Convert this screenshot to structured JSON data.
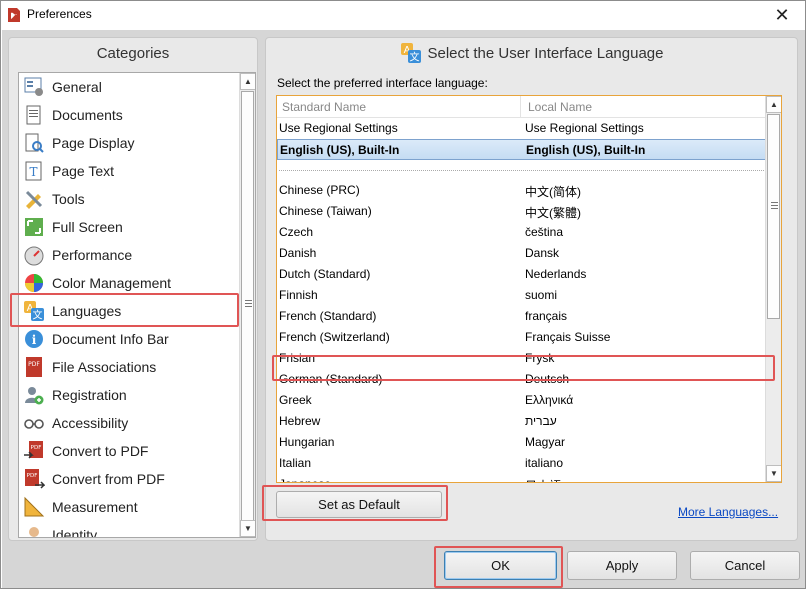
{
  "window": {
    "title": "Preferences",
    "close_glyph": "✕"
  },
  "categories": {
    "header": "Categories",
    "items": [
      {
        "label": "General",
        "icon": "general-settings-icon"
      },
      {
        "label": "Documents",
        "icon": "documents-icon"
      },
      {
        "label": "Page Display",
        "icon": "page-display-icon"
      },
      {
        "label": "Page Text",
        "icon": "page-text-icon"
      },
      {
        "label": "Tools",
        "icon": "tools-icon"
      },
      {
        "label": "Full Screen",
        "icon": "full-screen-icon"
      },
      {
        "label": "Performance",
        "icon": "performance-icon"
      },
      {
        "label": "Color Management",
        "icon": "color-management-icon"
      },
      {
        "label": "Languages",
        "icon": "languages-icon"
      },
      {
        "label": "Document Info Bar",
        "icon": "info-icon"
      },
      {
        "label": "File Associations",
        "icon": "pdf-file-icon"
      },
      {
        "label": "Registration",
        "icon": "registration-icon"
      },
      {
        "label": "Accessibility",
        "icon": "accessibility-glasses-icon"
      },
      {
        "label": "Convert to PDF",
        "icon": "convert-to-pdf-icon"
      },
      {
        "label": "Convert from PDF",
        "icon": "convert-from-pdf-icon"
      },
      {
        "label": "Measurement",
        "icon": "measurement-icon"
      },
      {
        "label": "Identity",
        "icon": "identity-icon"
      }
    ],
    "selected": "Languages"
  },
  "language_panel": {
    "header": "Select the User Interface Language",
    "prompt": "Select the preferred interface language:",
    "columns": {
      "standard": "Standard Name",
      "local": "Local Name"
    },
    "top_rows": [
      {
        "standard": "Use Regional Settings",
        "local": "Use Regional Settings"
      },
      {
        "standard": "English (US), Built-In",
        "local": "English (US), Built-In",
        "selected": true
      }
    ],
    "rows": [
      {
        "standard": "Chinese (PRC)",
        "local": "中文(简体)"
      },
      {
        "standard": "Chinese (Taiwan)",
        "local": "中文(繁體)"
      },
      {
        "standard": "Czech",
        "local": "čeština"
      },
      {
        "standard": "Danish",
        "local": "Dansk"
      },
      {
        "standard": "Dutch (Standard)",
        "local": "Nederlands"
      },
      {
        "standard": "Finnish",
        "local": "suomi"
      },
      {
        "standard": "French (Standard)",
        "local": "français"
      },
      {
        "standard": "French (Switzerland)",
        "local": "Français Suisse"
      },
      {
        "standard": "Frisian",
        "local": "Frysk"
      },
      {
        "standard": "German (Standard)",
        "local": "Deutsch"
      },
      {
        "standard": "Greek",
        "local": "Ελληνικά"
      },
      {
        "standard": "Hebrew",
        "local": "עברית"
      },
      {
        "standard": "Hungarian",
        "local": "Magyar"
      },
      {
        "standard": "Italian",
        "local": "italiano"
      },
      {
        "standard": "Japanese",
        "local": "日本語"
      }
    ],
    "set_default_label": "Set as Default",
    "more_languages_label": "More Languages..."
  },
  "footer": {
    "ok_label": "OK",
    "apply_label": "Apply",
    "cancel_label": "Cancel"
  },
  "colors": {
    "highlight": "#e05555",
    "selection": "#c5dcf3",
    "focus_border": "#e8a43b",
    "link": "#0b49c4"
  }
}
